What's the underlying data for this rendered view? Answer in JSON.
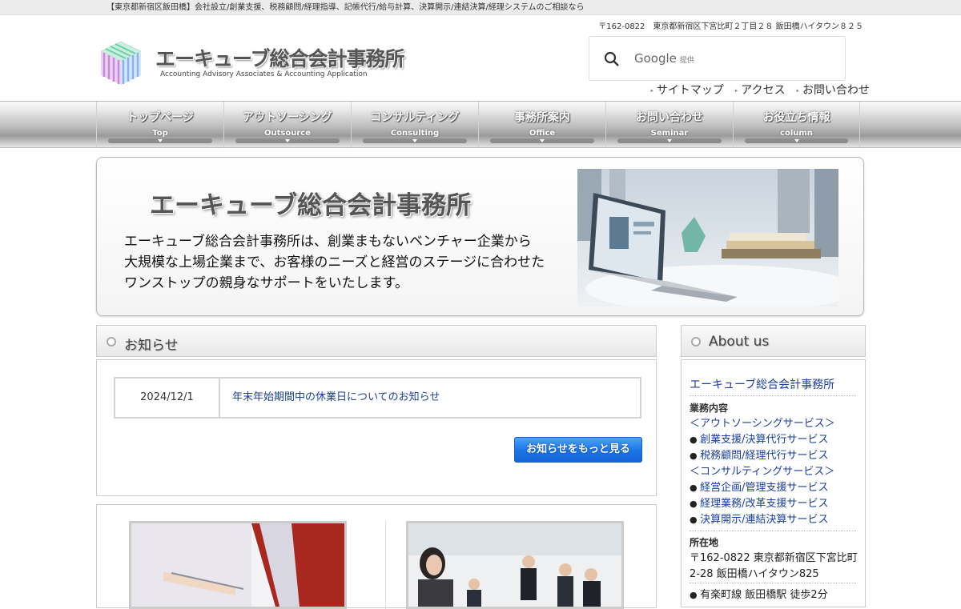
{
  "topbar": {
    "text": "【東京都新宿区飯田橋】会社設立/創業支援、税務顧問/経理指導、記帳代行/給与計算、決算開示/連結決算/経理システムのご相談なら"
  },
  "header": {
    "address": "〒162-0822　東京都新宿区下宮比町２丁目２８ 飯田橋ハイタウン８２５",
    "logo_title": "エーキューブ総合会計事務所",
    "logo_subtitle": "Accounting Advisory Associates & Accounting Application",
    "search": {
      "brand": "Google",
      "provided": "提供"
    },
    "links": [
      "サイトマップ",
      "アクセス",
      "お問い合わせ"
    ]
  },
  "nav": [
    {
      "jp": "トップページ",
      "en": "Top"
    },
    {
      "jp": "アウトソーシング",
      "en": "Outsource"
    },
    {
      "jp": "コンサルティング",
      "en": "Consulting"
    },
    {
      "jp": "事務所案内",
      "en": "Office"
    },
    {
      "jp": "お問い合わせ",
      "en": "Seminar"
    },
    {
      "jp": "お役立ち情報",
      "en": "column"
    }
  ],
  "hero": {
    "title": "エーキューブ総合会計事務所",
    "lines": [
      "エーキューブ総合会計事務所は、創業まもないベンチャー企業から",
      "大規模な上場企業まで、お客様のニーズと経営のステージに合わせた",
      "ワンストップの親身なサポートをいたします。"
    ]
  },
  "news": {
    "heading": "お知らせ",
    "items": [
      {
        "date": "2024/12/1",
        "title": "年末年始期間中の休業日についてのお知らせ"
      }
    ],
    "more_label": "お知らせをもっと見る"
  },
  "about": {
    "heading": "About us",
    "company": "エーキューブ総合会計事務所",
    "services_heading": "業務内容",
    "outsourcing": "＜アウトソーシングサービス＞",
    "outsourcing_items": [
      "創業支援/決算代行サービス",
      "税務顧問/経理代行サービス"
    ],
    "consulting": "＜コンサルティングサービス＞",
    "consulting_items": [
      "経営企画/管理支援サービス",
      "経理業務/改革支援サービス",
      "決算開示/連結決算サービス"
    ],
    "location_heading": "所在地",
    "location_lines": [
      "〒162-0822 東京都新宿区下宮比町",
      "2-28 飯田橋ハイタウン825"
    ],
    "station": "有楽町線 飯田橋駅 徒歩2分"
  },
  "colors": {
    "accent": "#1a73e6",
    "link": "#1a3fa0"
  }
}
